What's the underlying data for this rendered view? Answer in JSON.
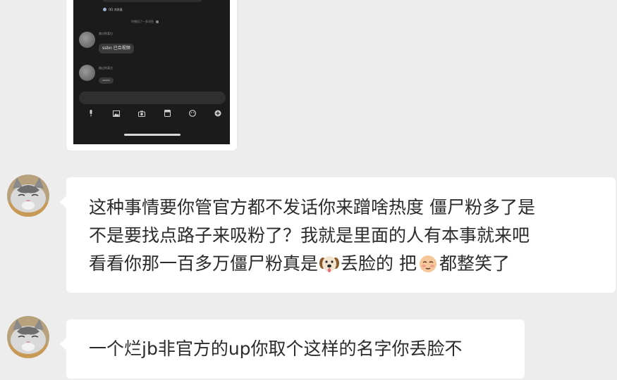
{
  "screenshot_message": {
    "source_label": "QQ 浏览器",
    "recall_notice": "你撤回了一条消息",
    "chat": [
      {
        "sender": "路过的某位",
        "text": "ssbn 已合视频"
      },
      {
        "sender": "路过的某位",
        "text": "xxxxxx"
      }
    ],
    "toolbar_icons": [
      "microphone-icon",
      "image-icon",
      "camera-icon",
      "red-packet-icon",
      "emoji-icon",
      "plus-icon"
    ]
  },
  "messages": [
    {
      "lines": [
        "这种事情要你管官方都不发话你来蹭啥热度 僵尸粉多了是",
        "不是要找点路子来吸粉了？我就是里面的人有本事就来吧"
      ],
      "line3": {
        "before_dog": "看看你那一百多万僵尸粉真是",
        "between": "丢脸的 把",
        "after_face": "都整笑了"
      },
      "emojis": [
        "dog-emoji",
        "sheepish-face-emoji"
      ]
    },
    {
      "text": "一个烂jb非官方的up你取个这样的名字你丢脸不"
    }
  ],
  "colors": {
    "background": "#ededed",
    "bubble": "#ffffff",
    "text": "#2b2b2b"
  }
}
